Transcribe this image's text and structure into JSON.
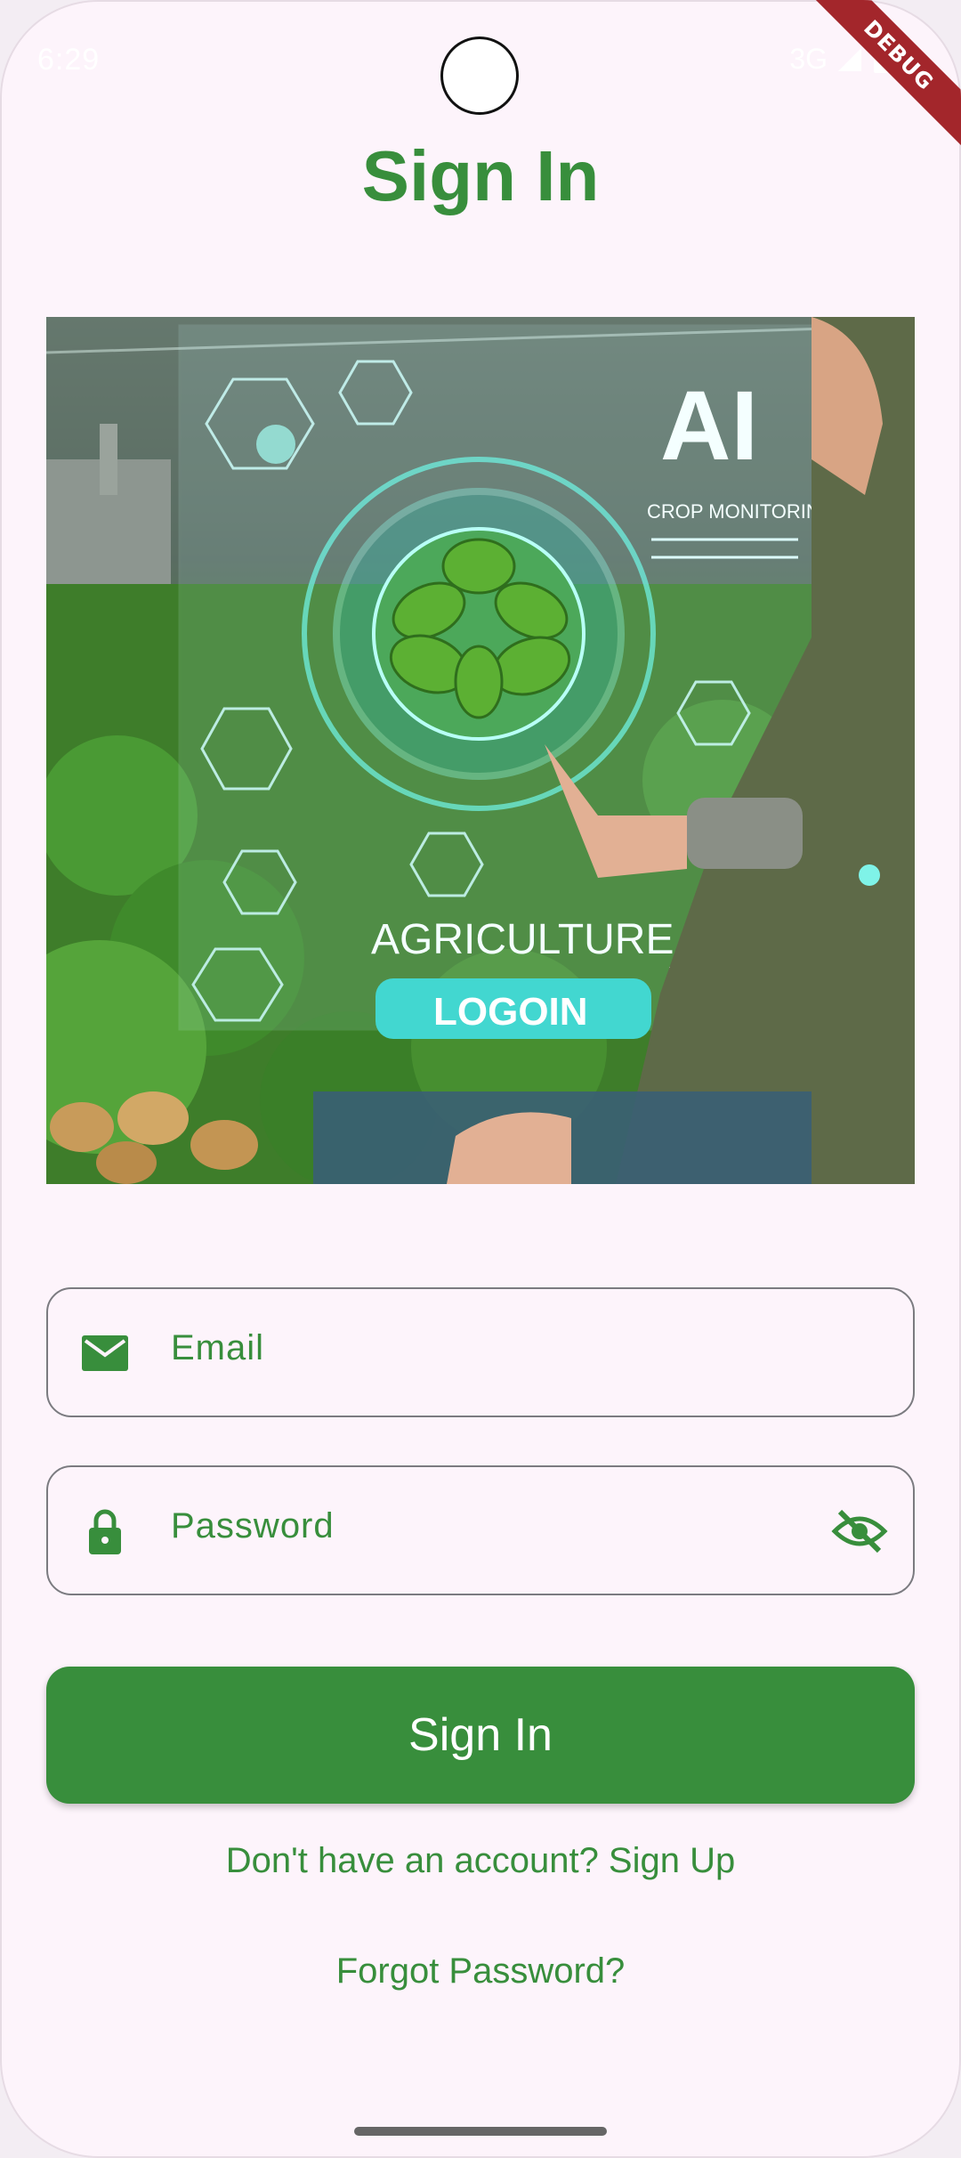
{
  "status_bar": {
    "time": "6:29",
    "network": "3G"
  },
  "debug_label": "DEBUG",
  "page": {
    "title": "Sign In"
  },
  "hero_image": {
    "description_icon": "ai-agriculture-illustration",
    "overlay_texts": {
      "ai": "AI",
      "crop": "CROP MONITORING",
      "agriculture": "AGRICULTURE",
      "login": "LOGOIN"
    }
  },
  "form": {
    "email": {
      "placeholder": "Email",
      "icon": "email-icon"
    },
    "password": {
      "placeholder": "Password",
      "icon": "lock-icon",
      "toggle_icon": "visibility-off-icon"
    },
    "submit_label": "Sign In"
  },
  "links": {
    "signup": "Don't have an account? Sign Up",
    "forgot": "Forgot Password?"
  },
  "colors": {
    "primary": "#388e3c",
    "background": "#fdf4fb",
    "ribbon": "#a3262b"
  }
}
